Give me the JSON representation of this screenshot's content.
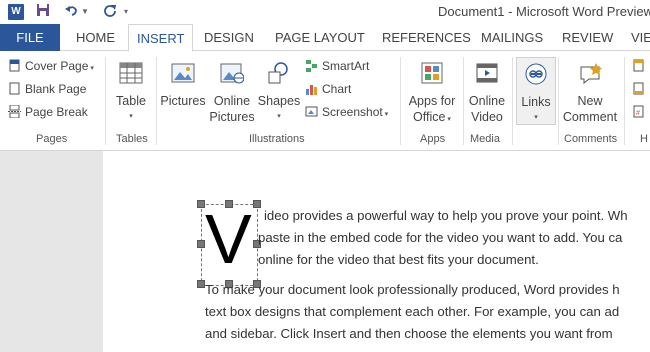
{
  "window": {
    "title": "Document1 - Microsoft Word Preview"
  },
  "app_logo": {
    "text": "W"
  },
  "tabs": {
    "file": "FILE",
    "home": "HOME",
    "insert": "INSERT",
    "design": "DESIGN",
    "page_layout": "PAGE LAYOUT",
    "references": "REFERENCES",
    "mailings": "MAILINGS",
    "review": "REVIEW",
    "view": "VIE"
  },
  "ribbon": {
    "pages": {
      "cover_page": "Cover Page",
      "blank_page": "Blank Page",
      "page_break": "Page Break",
      "label": "Pages"
    },
    "tables": {
      "table": "Table",
      "label": "Tables"
    },
    "illustrations": {
      "pictures": "Pictures",
      "online_pictures_1": "Online",
      "online_pictures_2": "Pictures",
      "shapes": "Shapes",
      "smartart": "SmartArt",
      "chart": "Chart",
      "screenshot": "Screenshot",
      "label": "Illustrations"
    },
    "apps": {
      "apps_1": "Apps for",
      "apps_2": "Office",
      "label": "Apps"
    },
    "media": {
      "online_video_1": "Online",
      "online_video_2": "Video",
      "label": "Media"
    },
    "links": {
      "links": "Links"
    },
    "comments": {
      "new_1": "New",
      "new_2": "Comment",
      "label": "Comments"
    },
    "header_footer": {
      "label": "H"
    }
  },
  "document": {
    "drop_cap": "V",
    "lines": [
      "ideo provides a powerful way to help you prove your point. Wh",
      "paste in the embed code for the video you want to add. You ca",
      "online for the video that best fits your document.",
      "To make your document look professionally produced, Word provides h",
      "text box designs that complement each other. For example, you can ad",
      "and sidebar. Click Insert and then choose the elements you want from"
    ]
  },
  "colors": {
    "accent": "#2b579a",
    "ribbon_bg": "#ffffff",
    "canvas_bg": "#e6e6e6"
  }
}
